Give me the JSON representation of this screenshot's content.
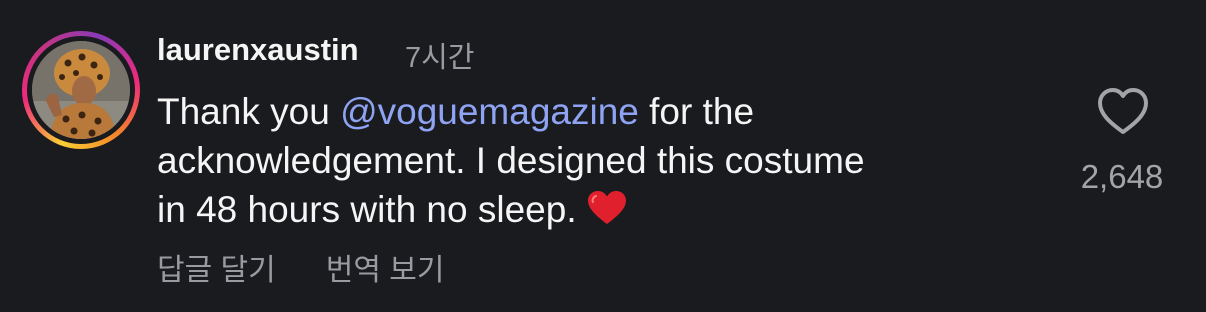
{
  "comment": {
    "username": "laurenxaustin",
    "time": "7시간",
    "body": {
      "line1_prefix": "Thank you ",
      "mention": "@voguemagazine",
      "line1_suffix": " for the",
      "line2": "acknowledgement.  I designed this costume",
      "line3": "in 48 hours with no sleep.",
      "emoji": "red-heart-emoji"
    },
    "actions": {
      "reply": "답글 달기",
      "translate": "번역 보기"
    },
    "likes": {
      "icon": "heart-outline-icon",
      "count": "2,648"
    }
  },
  "colors": {
    "background": "#1a1b1f",
    "text": "#f5f5f5",
    "secondary_text": "#9a9ba0",
    "mention": "#8fa3f3",
    "emoji_heart": "#e0202d"
  }
}
